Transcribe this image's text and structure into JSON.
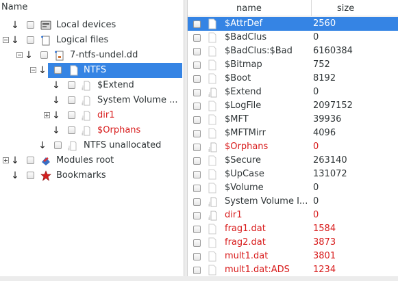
{
  "left": {
    "header": "Name",
    "tree": [
      {
        "label": "Local devices",
        "icon": "drive-icon",
        "red": false
      },
      {
        "label": "Logical files",
        "icon": "files-icon",
        "red": false
      },
      {
        "label": "7-ntfs-undel.dd",
        "icon": "image-file-icon",
        "red": false
      },
      {
        "label": "NTFS",
        "icon": "file-icon",
        "red": false
      },
      {
        "label": "$Extend",
        "icon": "file-icon",
        "red": false
      },
      {
        "label": "System Volume ...",
        "icon": "file-icon",
        "red": false
      },
      {
        "label": "dir1",
        "icon": "file-icon",
        "red": true
      },
      {
        "label": "$Orphans",
        "icon": "file-icon",
        "red": true
      },
      {
        "label": "NTFS unallocated",
        "icon": "file-icon",
        "red": false
      },
      {
        "label": "Modules root",
        "icon": "modules-icon",
        "red": false
      },
      {
        "label": "Bookmarks",
        "icon": "bookmark-star-icon",
        "red": false
      }
    ]
  },
  "table": {
    "col_name": "name",
    "col_size": "size",
    "rows": [
      {
        "name": "$AttrDef",
        "size": "2560",
        "red": false,
        "selected": true,
        "folder": false
      },
      {
        "name": "$BadClus",
        "size": "0",
        "red": false,
        "selected": false,
        "folder": false
      },
      {
        "name": "$BadClus:$Bad",
        "size": "6160384",
        "red": false,
        "selected": false,
        "folder": false
      },
      {
        "name": "$Bitmap",
        "size": "752",
        "red": false,
        "selected": false,
        "folder": false
      },
      {
        "name": "$Boot",
        "size": "8192",
        "red": false,
        "selected": false,
        "folder": false
      },
      {
        "name": "$Extend",
        "size": "0",
        "red": false,
        "selected": false,
        "folder": true
      },
      {
        "name": "$LogFile",
        "size": "2097152",
        "red": false,
        "selected": false,
        "folder": false
      },
      {
        "name": "$MFT",
        "size": "39936",
        "red": false,
        "selected": false,
        "folder": false
      },
      {
        "name": "$MFTMirr",
        "size": "4096",
        "red": false,
        "selected": false,
        "folder": false
      },
      {
        "name": "$Orphans",
        "size": "0",
        "red": true,
        "selected": false,
        "folder": true
      },
      {
        "name": "$Secure",
        "size": "263140",
        "red": false,
        "selected": false,
        "folder": false
      },
      {
        "name": "$UpCase",
        "size": "131072",
        "red": false,
        "selected": false,
        "folder": false
      },
      {
        "name": "$Volume",
        "size": "0",
        "red": false,
        "selected": false,
        "folder": false
      },
      {
        "name": "System Volume I...",
        "size": "0",
        "red": false,
        "selected": false,
        "folder": true
      },
      {
        "name": "dir1",
        "size": "0",
        "red": true,
        "selected": false,
        "folder": true
      },
      {
        "name": "frag1.dat",
        "size": "1584",
        "red": true,
        "selected": false,
        "folder": false
      },
      {
        "name": "frag2.dat",
        "size": "3873",
        "red": true,
        "selected": false,
        "folder": false
      },
      {
        "name": "mult1.dat",
        "size": "3801",
        "red": true,
        "selected": false,
        "folder": false
      },
      {
        "name": "mult1.dat:ADS",
        "size": "1234",
        "red": true,
        "selected": false,
        "folder": false
      }
    ]
  },
  "colors": {
    "selection": "#3584e4",
    "deleted": "#d81b1b",
    "text": "#2e3436"
  }
}
